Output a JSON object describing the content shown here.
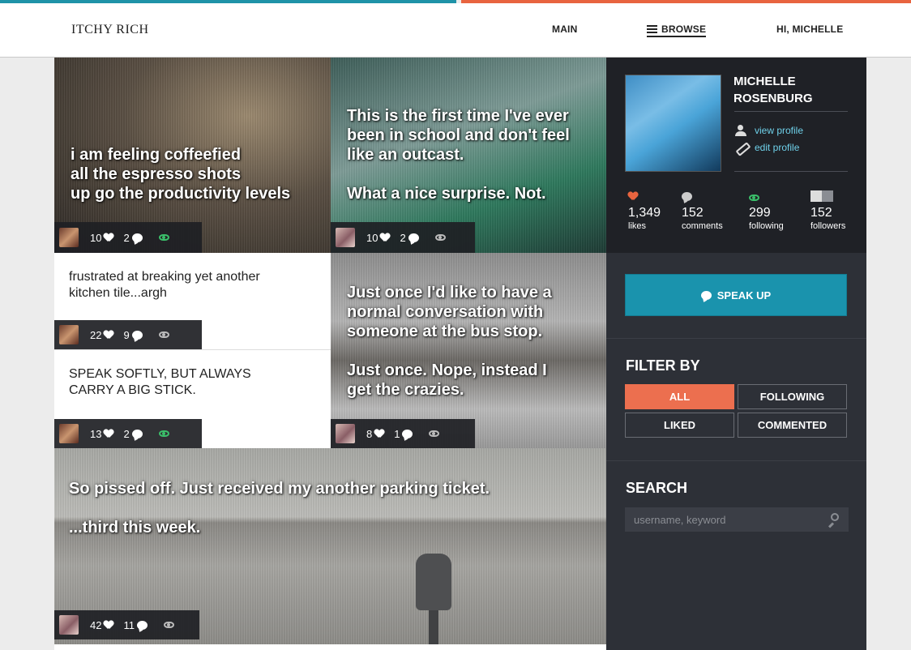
{
  "header": {
    "logo": "ITCHY RICH",
    "nav_main": "MAIN",
    "nav_browse": "BROWSE",
    "nav_user": "HI, MICHELLE"
  },
  "colors": {
    "teal": "#1f93a8",
    "orange": "#e8643f",
    "active_filter": "#ec6f4f"
  },
  "feed": [
    {
      "text": "i am feeling coffeefied\nall the espresso shots\nup go the productivity levels",
      "likes": "10",
      "comments": "2",
      "viewed": true,
      "avatar": "male"
    },
    {
      "text": "This is the first time I've ever\nbeen in school and don't feel\nlike an outcast.\n\nWhat a nice surprise. Not.",
      "likes": "10",
      "comments": "2",
      "viewed": false,
      "avatar": "female"
    },
    {
      "text": "frustrated at breaking yet another\nkitchen tile...argh",
      "likes": "22",
      "comments": "9",
      "viewed": false,
      "avatar": "male"
    },
    {
      "text": "Just once I'd like to have a\nnormal conversation with\nsomeone at the bus stop.\n\nJust once. Nope, instead I\nget the crazies.",
      "likes": "8",
      "comments": "1",
      "viewed": false,
      "avatar": "female"
    },
    {
      "text": "SPEAK SOFTLY, BUT ALWAYS\nCARRY A BIG STICK.",
      "likes": "13",
      "comments": "2",
      "viewed": true,
      "avatar": "male"
    },
    {
      "text": "So pissed off. Just received my another parking ticket.\n\n...third this week.",
      "likes": "42",
      "comments": "11",
      "viewed": false,
      "avatar": "female"
    }
  ],
  "profile": {
    "name": "MICHELLE ROSENBURG",
    "view_profile": "view profile",
    "edit_profile": "edit profile",
    "stats": [
      {
        "num": "1,349",
        "label": "likes"
      },
      {
        "num": "152",
        "label": "comments"
      },
      {
        "num": "299",
        "label": "following"
      },
      {
        "num": "152",
        "label": "followers"
      }
    ]
  },
  "speak_up": "SPEAK UP",
  "filter": {
    "title": "FILTER BY",
    "options": [
      "ALL",
      "FOLLOWING",
      "LIKED",
      "COMMENTED"
    ],
    "selected": "ALL"
  },
  "search": {
    "title": "SEARCH",
    "placeholder": "username, keyword"
  }
}
